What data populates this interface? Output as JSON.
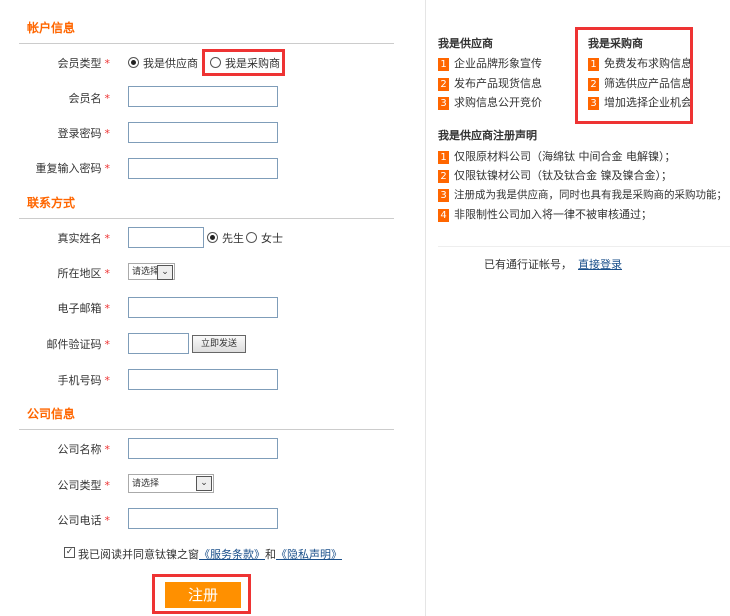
{
  "account": {
    "title": "帐户信息",
    "member_type_label": "会员类型",
    "supplier_option": "我是供应商",
    "buyer_option": "我是采购商",
    "member_type_selected": "supplier",
    "username_label": "会员名",
    "password_label": "登录密码",
    "confirm_password_label": "重复输入密码"
  },
  "contact": {
    "title": "联系方式",
    "realname_label": "真实姓名",
    "gender_male": "先生",
    "gender_female": "女士",
    "gender_selected": "male",
    "region_label": "所在地区",
    "region_select": "请选择",
    "email_label": "电子邮箱",
    "email_code_label": "邮件验证码",
    "send_button": "立即发送",
    "mobile_label": "手机号码"
  },
  "company": {
    "title": "公司信息",
    "name_label": "公司名称",
    "type_label": "公司类型",
    "type_select": "请选择",
    "phone_label": "公司电话"
  },
  "agreement": {
    "checked": true,
    "text": "我已阅读并同意钛镍之窗",
    "terms_link": "《服务条款》",
    "and": "和",
    "privacy_link": "《隐私声明》"
  },
  "submit_label": "注册",
  "required_mark": "*",
  "sidebar": {
    "supplier_title": "我是供应商",
    "supplier_items": [
      "企业品牌形象宣传",
      "发布产品现货信息",
      "求购信息公开竞价"
    ],
    "buyer_title": "我是采购商",
    "buyer_items": [
      "免费发布求购信息",
      "筛选供应产品信息",
      "增加选择企业机会"
    ],
    "declaration_title": "我是供应商注册声明",
    "declaration_items": [
      "仅限原材料公司（海绵钛  中间合金  电解镍）；",
      "仅限钛镍材公司（钛及钛合金    镍及镍合金）；",
      "注册成为我是供应商，同时也具有我是采购商的采购功能；",
      "非限制性公司加入将一律不被审核通过；"
    ],
    "login_prompt": "已有通行证帐号，",
    "login_link": "直接登录"
  },
  "colors": {
    "accent": "#ff6600",
    "button": "#ff9000",
    "highlight": "#ee3333"
  }
}
